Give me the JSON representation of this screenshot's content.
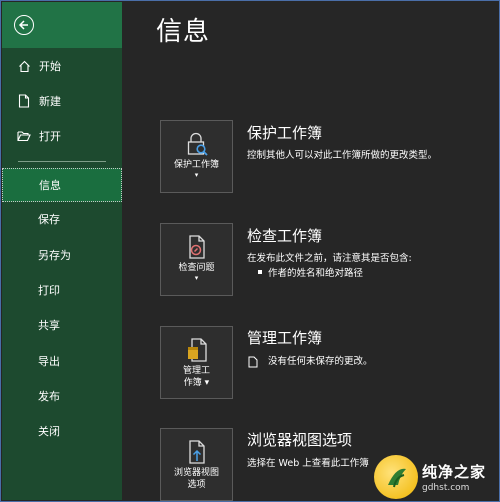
{
  "sidebar": {
    "back_label": "back",
    "items": [
      {
        "label": "开始",
        "icon": "home-icon"
      },
      {
        "label": "新建",
        "icon": "new-document-icon"
      },
      {
        "label": "打开",
        "icon": "folder-open-icon"
      },
      {
        "label": "信息"
      },
      {
        "label": "保存"
      },
      {
        "label": "另存为"
      },
      {
        "label": "打印"
      },
      {
        "label": "共享"
      },
      {
        "label": "导出"
      },
      {
        "label": "发布"
      },
      {
        "label": "关闭"
      }
    ],
    "active_item": "信息"
  },
  "main": {
    "title": "信息",
    "sections": [
      {
        "button_label": "保护工作簿",
        "icon": "lock-search-icon",
        "title": "保护工作簿",
        "description": "控制其他人可以对此工作簿所做的更改类型。"
      },
      {
        "button_label": "检查问题",
        "icon": "inspect-document-icon",
        "title": "检查工作簿",
        "description": "在发布此文件之前，请注意其是否包含:",
        "bullets": [
          "作者的姓名和绝对路径"
        ]
      },
      {
        "button_label_line1": "管理工",
        "button_label_line2": "作簿",
        "icon": "manage-workbook-icon",
        "title": "管理工作簿",
        "description": "没有任何未保存的更改。"
      },
      {
        "button_label_line1": "浏览器视图",
        "button_label_line2": "选项",
        "icon": "browser-view-icon",
        "title": "浏览器视图选项",
        "description": "选择在 Web 上查看此工作簿"
      }
    ]
  },
  "watermark": {
    "name": "纯净之家",
    "url": "gdhst.com"
  },
  "colors": {
    "sidebar_bg": "#1d4a2f",
    "accent_green": "#217346",
    "main_bg": "#262626"
  }
}
